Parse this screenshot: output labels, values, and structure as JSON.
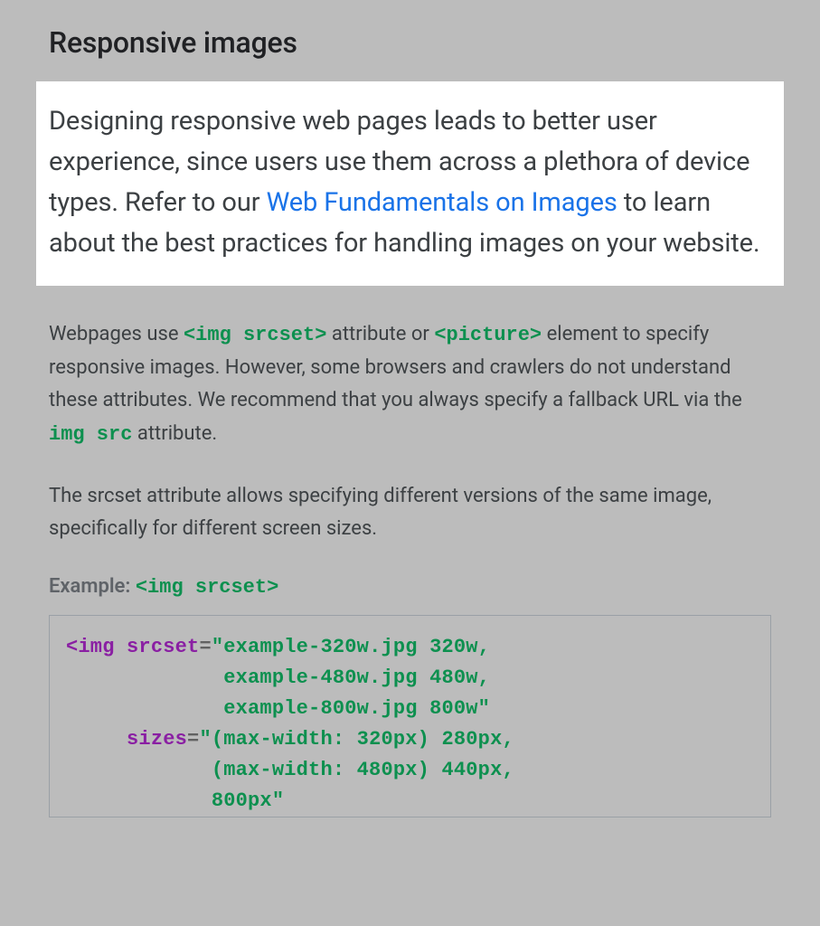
{
  "heading": "Responsive images",
  "intro": {
    "before_link": "Designing responsive web pages leads to better user experience, since users use them across a plethora of device types. Refer to our ",
    "link_text": "Web Fundamentals on Images",
    "after_link": " to learn about the best practices for handling images on your website."
  },
  "para2": {
    "t1": "Webpages use ",
    "code1": "<img srcset>",
    "t2": " attribute or ",
    "code2": "<picture>",
    "t3": " element to specify responsive images. However, some browsers and crawlers do not understand these attributes. We recommend that you always specify a fallback URL via the ",
    "code3": "img src",
    "t4": " attribute."
  },
  "para3": "The srcset attribute allows specifying different versions of the same image, specifically for different screen sizes.",
  "example": {
    "label": "Example: ",
    "code": "<img srcset>"
  },
  "codeblock": {
    "l1_tag": "<img ",
    "l1_attr": "srcset",
    "l1_eq": "=",
    "l1_val": "\"example-320w.jpg 320w,",
    "l2_val": "             example-480w.jpg 480w,",
    "l3_val": "             example-800w.jpg 800w\"",
    "l4_attr": "     sizes",
    "l4_eq": "=",
    "l4_val": "\"(max-width: 320px) 280px,",
    "l5_val": "            (max-width: 480px) 440px,",
    "l6_val": "            800px\""
  }
}
